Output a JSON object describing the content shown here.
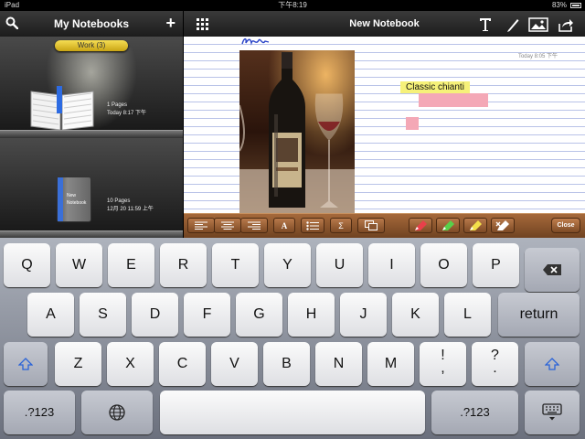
{
  "status_bar": {
    "device": "iPad",
    "time": "下午8:19",
    "battery": "83%"
  },
  "sidebar": {
    "title": "My Notebooks",
    "add_label": "+",
    "group_label": "Work (3)",
    "notebooks": [
      {
        "pages": "1 Pages",
        "modified": "Today 8:17 下午"
      },
      {
        "pages": "10 Pages",
        "modified": "12月 20 11:59 上午",
        "cover_label": "New Notebook"
      }
    ]
  },
  "main": {
    "title": "New Notebook",
    "timestamp": "Today 8:05 下午",
    "notes": {
      "yellow_text": "Classic chianti"
    },
    "close_label": "Close",
    "highlighter_colors": [
      "#e8404a",
      "#58d04a",
      "#f3e04a",
      "#ffffff"
    ],
    "toolbar_icons": [
      "text-icon",
      "pen-icon",
      "image-icon",
      "share-icon"
    ]
  },
  "keyboard": {
    "row1": [
      "Q",
      "W",
      "E",
      "R",
      "T",
      "Y",
      "U",
      "I",
      "O",
      "P"
    ],
    "row2": [
      "A",
      "S",
      "D",
      "F",
      "G",
      "H",
      "J",
      "K",
      "L"
    ],
    "row3": [
      "Z",
      "X",
      "C",
      "V",
      "B",
      "N",
      "M"
    ],
    "row3_punct": [
      [
        "!",
        ","
      ],
      [
        "?",
        "."
      ]
    ],
    "return_label": "return",
    "numbers_label": ".?123"
  }
}
